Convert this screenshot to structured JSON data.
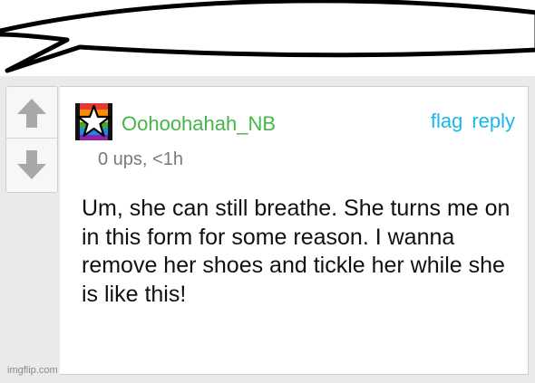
{
  "comment": {
    "username": "Oohoohahah_NB",
    "meta": "0 ups, <1h",
    "actions": {
      "flag": "flag",
      "reply": "reply"
    },
    "text": "Um, she can still breathe. She turns me on in this form for some reason. I wanna remove her shoes and tickle her while she is like this!"
  },
  "watermark": "imgflip.com",
  "colors": {
    "accent": "#1ab8e8",
    "username": "#45b649",
    "panel": "#eaeaea"
  },
  "icons": {
    "upvote": "arrow-up-icon",
    "downvote": "arrow-down-icon",
    "avatar": "rainbow-star-avatar"
  }
}
